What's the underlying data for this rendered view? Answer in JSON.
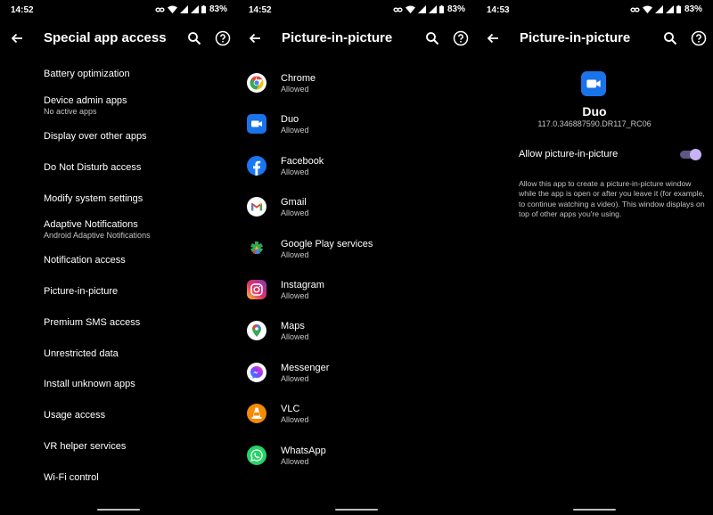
{
  "screens": [
    {
      "status": {
        "time": "14:52",
        "battery": "83%"
      },
      "title": "Special app access",
      "items": [
        {
          "label": "Battery optimization",
          "sub": ""
        },
        {
          "label": "Device admin apps",
          "sub": "No active apps"
        },
        {
          "label": "Display over other apps",
          "sub": ""
        },
        {
          "label": "Do Not Disturb access",
          "sub": ""
        },
        {
          "label": "Modify system settings",
          "sub": ""
        },
        {
          "label": "Adaptive Notifications",
          "sub": "Android Adaptive Notifications"
        },
        {
          "label": "Notification access",
          "sub": ""
        },
        {
          "label": "Picture-in-picture",
          "sub": ""
        },
        {
          "label": "Premium SMS access",
          "sub": ""
        },
        {
          "label": "Unrestricted data",
          "sub": ""
        },
        {
          "label": "Install unknown apps",
          "sub": ""
        },
        {
          "label": "Usage access",
          "sub": ""
        },
        {
          "label": "VR helper services",
          "sub": ""
        },
        {
          "label": "Wi-Fi control",
          "sub": ""
        }
      ]
    },
    {
      "status": {
        "time": "14:52",
        "battery": "83%"
      },
      "title": "Picture-in-picture",
      "apps": [
        {
          "name": "Chrome",
          "status": "Allowed",
          "icon": "chrome-icon"
        },
        {
          "name": "Duo",
          "status": "Allowed",
          "icon": "duo-icon"
        },
        {
          "name": "Facebook",
          "status": "Allowed",
          "icon": "facebook-icon"
        },
        {
          "name": "Gmail",
          "status": "Allowed",
          "icon": "gmail-icon"
        },
        {
          "name": "Google Play services",
          "status": "Allowed",
          "icon": "google-play-services-icon"
        },
        {
          "name": "Instagram",
          "status": "Allowed",
          "icon": "instagram-icon"
        },
        {
          "name": "Maps",
          "status": "Allowed",
          "icon": "maps-icon"
        },
        {
          "name": "Messenger",
          "status": "Allowed",
          "icon": "messenger-icon"
        },
        {
          "name": "VLC",
          "status": "Allowed",
          "icon": "vlc-icon"
        },
        {
          "name": "WhatsApp",
          "status": "Allowed",
          "icon": "whatsapp-icon"
        }
      ]
    },
    {
      "status": {
        "time": "14:53",
        "battery": "83%"
      },
      "title": "Picture-in-picture",
      "app_name": "Duo",
      "version": "117.0.346887590.DR117_RC06",
      "toggle_label": "Allow picture-in-picture",
      "toggle_on": true,
      "description": "Allow this app to create a picture-in-picture window while the app is open or after you leave it (for example, to continue watching a video). This window displays on top of other apps you're using."
    }
  ],
  "colors": {
    "accent": "#c6b4f5",
    "track": "#5d5784",
    "duo": "#1a73e8",
    "secondary_text": "#c4c4c4"
  }
}
